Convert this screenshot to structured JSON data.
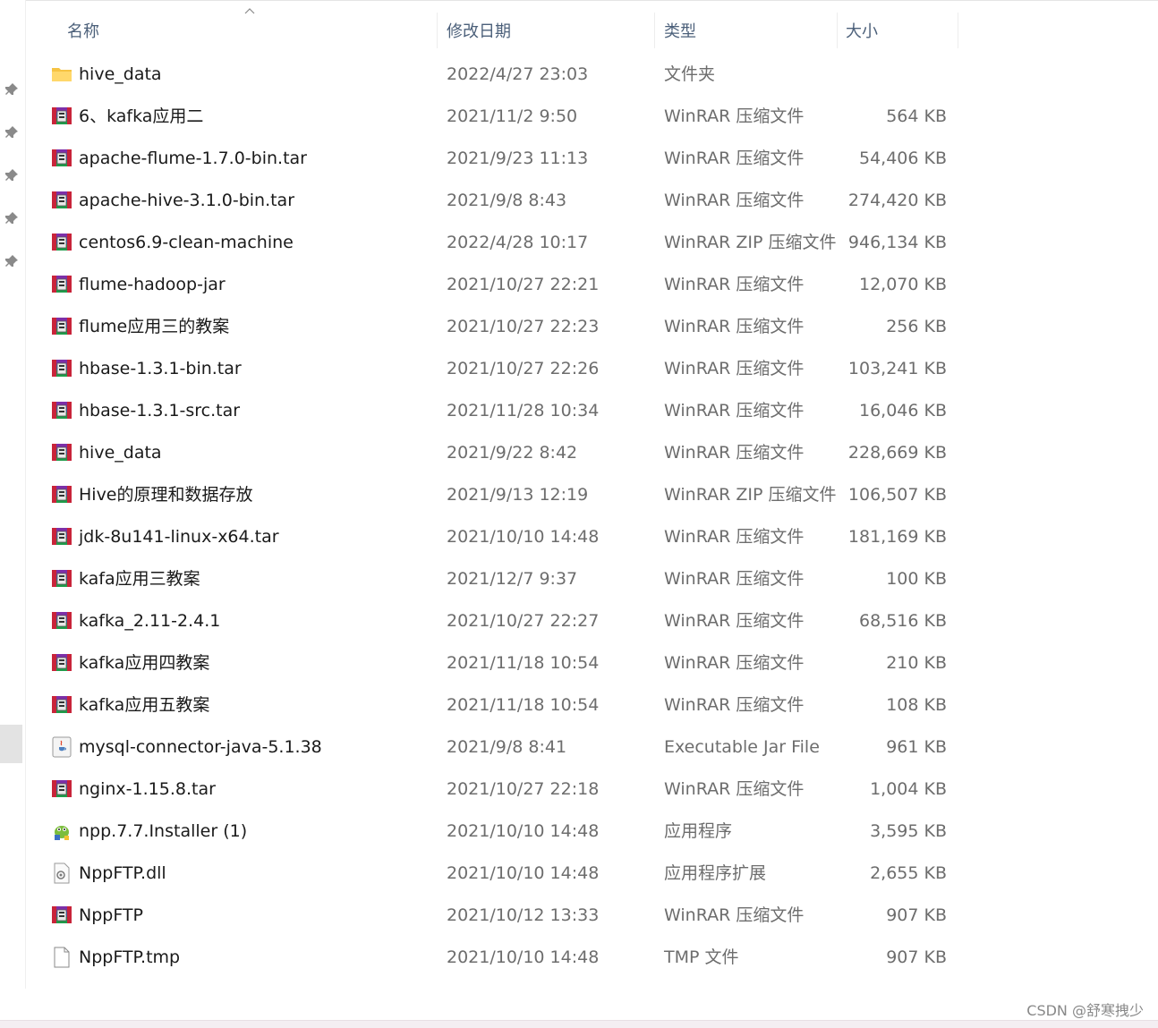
{
  "columns": {
    "name": "名称",
    "date": "修改日期",
    "type": "类型",
    "size": "大小"
  },
  "sort": {
    "column": "name",
    "direction": "ascending"
  },
  "files": [
    {
      "name": "hive_data",
      "date": "2022/4/27 23:03",
      "type": "文件夹",
      "size": "",
      "icon": "folder-icon"
    },
    {
      "name": "6、kafka应用二",
      "date": "2021/11/2 9:50",
      "type": "WinRAR 压缩文件",
      "size": "564 KB",
      "icon": "winrar-archive-icon"
    },
    {
      "name": "apache-flume-1.7.0-bin.tar",
      "date": "2021/9/23 11:13",
      "type": "WinRAR 压缩文件",
      "size": "54,406 KB",
      "icon": "winrar-archive-icon"
    },
    {
      "name": "apache-hive-3.1.0-bin.tar",
      "date": "2021/9/8 8:43",
      "type": "WinRAR 压缩文件",
      "size": "274,420 KB",
      "icon": "winrar-archive-icon"
    },
    {
      "name": "centos6.9-clean-machine",
      "date": "2022/4/28 10:17",
      "type": "WinRAR ZIP 压缩文件",
      "size": "946,134 KB",
      "icon": "winrar-archive-icon"
    },
    {
      "name": "flume-hadoop-jar",
      "date": "2021/10/27 22:21",
      "type": "WinRAR 压缩文件",
      "size": "12,070 KB",
      "icon": "winrar-archive-icon"
    },
    {
      "name": "flume应用三的教案",
      "date": "2021/10/27 22:23",
      "type": "WinRAR 压缩文件",
      "size": "256 KB",
      "icon": "winrar-archive-icon"
    },
    {
      "name": "hbase-1.3.1-bin.tar",
      "date": "2021/10/27 22:26",
      "type": "WinRAR 压缩文件",
      "size": "103,241 KB",
      "icon": "winrar-archive-icon"
    },
    {
      "name": "hbase-1.3.1-src.tar",
      "date": "2021/11/28 10:34",
      "type": "WinRAR 压缩文件",
      "size": "16,046 KB",
      "icon": "winrar-archive-icon"
    },
    {
      "name": "hive_data",
      "date": "2021/9/22 8:42",
      "type": "WinRAR 压缩文件",
      "size": "228,669 KB",
      "icon": "winrar-archive-icon"
    },
    {
      "name": "Hive的原理和数据存放",
      "date": "2021/9/13 12:19",
      "type": "WinRAR ZIP 压缩文件",
      "size": "106,507 KB",
      "icon": "winrar-archive-icon"
    },
    {
      "name": "jdk-8u141-linux-x64.tar",
      "date": "2021/10/10 14:48",
      "type": "WinRAR 压缩文件",
      "size": "181,169 KB",
      "icon": "winrar-archive-icon"
    },
    {
      "name": "kafa应用三教案",
      "date": "2021/12/7 9:37",
      "type": "WinRAR 压缩文件",
      "size": "100 KB",
      "icon": "winrar-archive-icon"
    },
    {
      "name": "kafka_2.11-2.4.1",
      "date": "2021/10/27 22:27",
      "type": "WinRAR 压缩文件",
      "size": "68,516 KB",
      "icon": "winrar-archive-icon"
    },
    {
      "name": "kafka应用四教案",
      "date": "2021/11/18 10:54",
      "type": "WinRAR 压缩文件",
      "size": "210 KB",
      "icon": "winrar-archive-icon"
    },
    {
      "name": "kafka应用五教案",
      "date": "2021/11/18 10:54",
      "type": "WinRAR 压缩文件",
      "size": "108 KB",
      "icon": "winrar-archive-icon"
    },
    {
      "name": "mysql-connector-java-5.1.38",
      "date": "2021/9/8 8:41",
      "type": "Executable Jar File",
      "size": "961 KB",
      "icon": "java-jar-icon"
    },
    {
      "name": "nginx-1.15.8.tar",
      "date": "2021/10/27 22:18",
      "type": "WinRAR 压缩文件",
      "size": "1,004 KB",
      "icon": "winrar-archive-icon"
    },
    {
      "name": "npp.7.7.Installer (1)",
      "date": "2021/10/10 14:48",
      "type": "应用程序",
      "size": "3,595 KB",
      "icon": "notepad-plus-plus-icon"
    },
    {
      "name": "NppFTP.dll",
      "date": "2021/10/10 14:48",
      "type": "应用程序扩展",
      "size": "2,655 KB",
      "icon": "dll-file-icon"
    },
    {
      "name": "NppFTP",
      "date": "2021/10/12 13:33",
      "type": "WinRAR 压缩文件",
      "size": "907 KB",
      "icon": "winrar-archive-icon"
    },
    {
      "name": "NppFTP.tmp",
      "date": "2021/10/10 14:48",
      "type": "TMP 文件",
      "size": "907 KB",
      "icon": "blank-file-icon"
    }
  ],
  "nav_pins": [
    "pin-icon",
    "pin-icon",
    "pin-icon",
    "pin-icon",
    "pin-icon"
  ],
  "watermark": "CSDN @舒寒拽少"
}
